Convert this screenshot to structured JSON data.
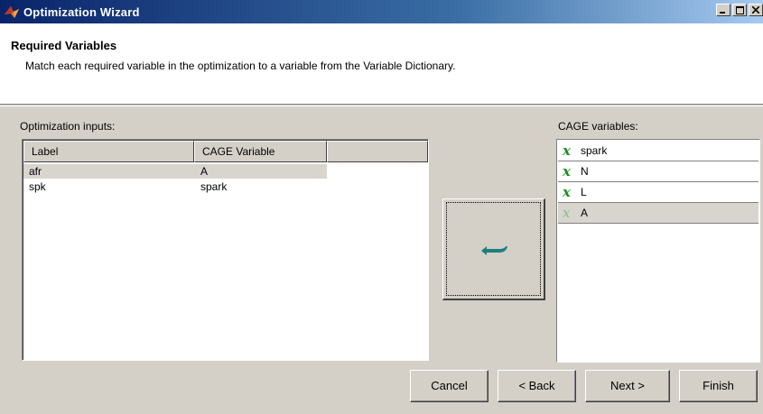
{
  "window": {
    "title": "Optimization Wizard",
    "controls": [
      "minimize",
      "maximize",
      "close"
    ]
  },
  "header": {
    "title": "Required Variables",
    "description": "Match each required variable in the optimization to a variable from the Variable Dictionary."
  },
  "optimization_inputs": {
    "label": "Optimization inputs:",
    "columns": [
      "Label",
      "CAGE Variable",
      ""
    ],
    "rows": [
      {
        "label": "afr",
        "cage_variable": "A",
        "selected": true
      },
      {
        "label": "spk",
        "cage_variable": "spark",
        "selected": false
      }
    ]
  },
  "assign_button": {
    "icon": "assign-arrow-icon"
  },
  "cage_variables": {
    "label": "CAGE variables:",
    "items": [
      {
        "name": "spark",
        "icon": "variable-x-icon",
        "selected": false
      },
      {
        "name": "N",
        "icon": "variable-x-icon",
        "selected": false
      },
      {
        "name": "L",
        "icon": "variable-x-icon",
        "selected": false
      },
      {
        "name": "A",
        "icon": "variable-x-icon",
        "selected": true
      }
    ]
  },
  "buttons": {
    "cancel": "Cancel",
    "back": "< Back",
    "next": "Next >",
    "finish": "Finish"
  },
  "colors": {
    "titlebar_start": "#0a246a",
    "titlebar_end": "#a6caf0",
    "window_bg": "#d4d0c8",
    "variable_icon": "#1f8f1f",
    "assign_arrow": "#1f7f7f"
  }
}
